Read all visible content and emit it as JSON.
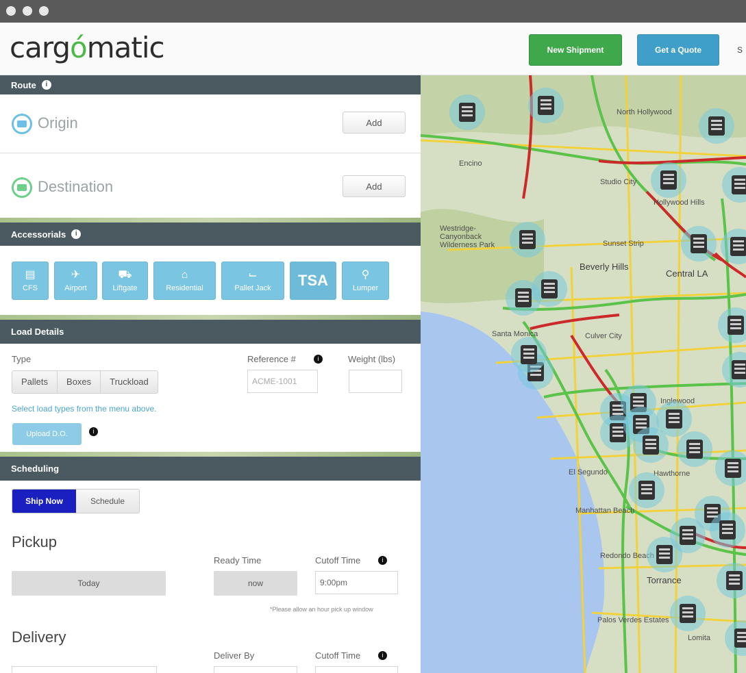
{
  "window": {
    "title": ""
  },
  "header": {
    "logo_prefix": "carg",
    "logo_o": "ó",
    "logo_suffix": "matic",
    "new_shipment": "New Shipment",
    "get_quote": "Get a Quote",
    "cut_text": "S"
  },
  "route": {
    "title": "Route",
    "origin": "Origin",
    "destination": "Destination",
    "add_label": "Add"
  },
  "accessorials": {
    "title": "Accessorials",
    "items": [
      {
        "label": "CFS",
        "icon": "warehouse-icon"
      },
      {
        "label": "Airport",
        "icon": "airplane-icon"
      },
      {
        "label": "Liftgate",
        "icon": "liftgate-truck-icon"
      },
      {
        "label": "Residential",
        "icon": "house-icon"
      },
      {
        "label": "Pallet Jack",
        "icon": "pallet-jack-icon"
      },
      {
        "label": "TSA",
        "icon": "tsa-icon"
      },
      {
        "label": "Lumper",
        "icon": "lumper-icon"
      }
    ]
  },
  "load": {
    "title": "Load Details",
    "type_label": "Type",
    "types": [
      "Pallets",
      "Boxes",
      "Truckload"
    ],
    "ref_label": "Reference #",
    "ref_placeholder": "ACME-1001",
    "weight_label": "Weight (lbs)",
    "weight_value": "",
    "hint": "Select load types from the menu above.",
    "upload": "Upload D.O."
  },
  "scheduling": {
    "title": "Scheduling",
    "ship_now": "Ship Now",
    "schedule": "Schedule",
    "pickup": "Pickup",
    "ready_time": "Ready Time",
    "cutoff_time": "Cutoff Time",
    "today": "Today",
    "now": "now",
    "cutoff_value": "9:00pm",
    "note": "*Please allow an hour pick up window",
    "delivery": "Delivery",
    "deliver_by": "Deliver By",
    "delivery_cutoff": "Cutoff Time"
  },
  "map": {
    "labels": [
      "North Hollywood",
      "Encino",
      "Studio City",
      "Beverly Hills",
      "Central LA",
      "Santa Monica",
      "Culver City",
      "Inglewood",
      "El Segundo",
      "Hawthorne",
      "Manhattan Beach",
      "Redondo Beach",
      "Torrance",
      "Palos Verdes Estates",
      "Lomita",
      "Hollywood Hills",
      "Sunset Strip",
      "Westridge-Canyonback Wilderness Park"
    ],
    "truck_count": 30
  }
}
